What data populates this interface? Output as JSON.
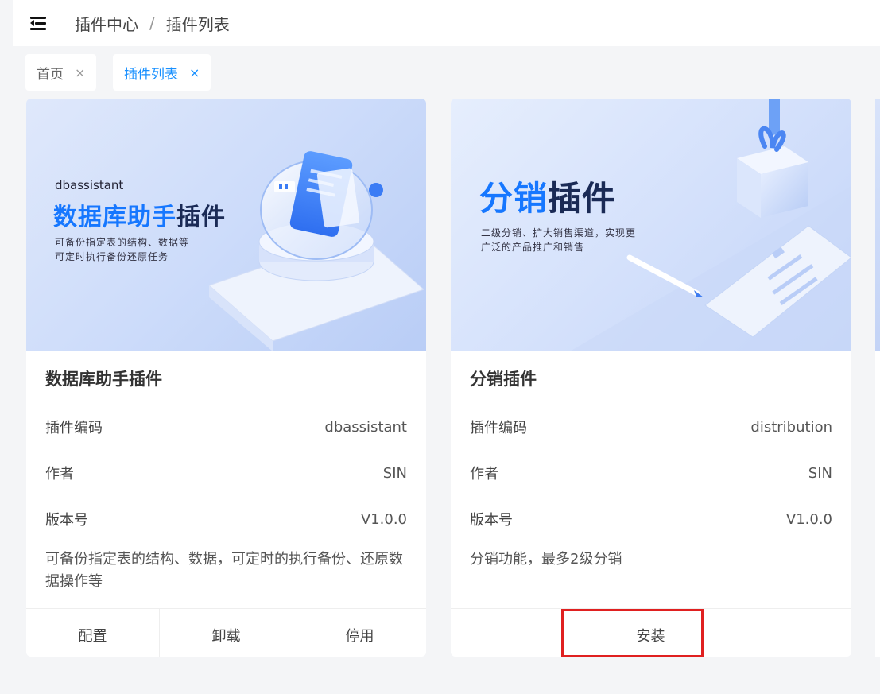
{
  "breadcrumb": {
    "parent": "插件中心",
    "separator": "/",
    "current": "插件列表"
  },
  "tabs": [
    {
      "label": "首页",
      "close": "×",
      "active": false
    },
    {
      "label": "插件列表",
      "close": "×",
      "active": true
    }
  ],
  "plugins": [
    {
      "cover": {
        "code_label": "dbassistant",
        "title_a": "数据库助手",
        "title_b": "插件",
        "line1": "可备份指定表的结构、数据等",
        "line2": "可定时执行备份还原任务"
      },
      "name": "数据库助手插件",
      "code_label": "插件编码",
      "code": "dbassistant",
      "author_label": "作者",
      "author": "SIN",
      "version_label": "版本号",
      "version": "V1.0.0",
      "description": "可备份指定表的结构、数据，可定时的执行备份、还原数据操作等",
      "actions": [
        "配置",
        "卸载",
        "停用"
      ]
    },
    {
      "cover": {
        "title_a": "分销",
        "title_b": "插件",
        "line1": "二级分销、扩大销售渠道，实现更",
        "line2": "广泛的产品推广和销售"
      },
      "name": "分销插件",
      "code_label": "插件编码",
      "code": "distribution",
      "author_label": "作者",
      "author": "SIN",
      "version_label": "版本号",
      "version": "V1.0.0",
      "description": "分销功能，最多2级分销",
      "actions": [
        "安装"
      ]
    }
  ],
  "colors": {
    "accent": "#1890ff",
    "highlight": "#e02020",
    "background": "#f4f5f7"
  }
}
